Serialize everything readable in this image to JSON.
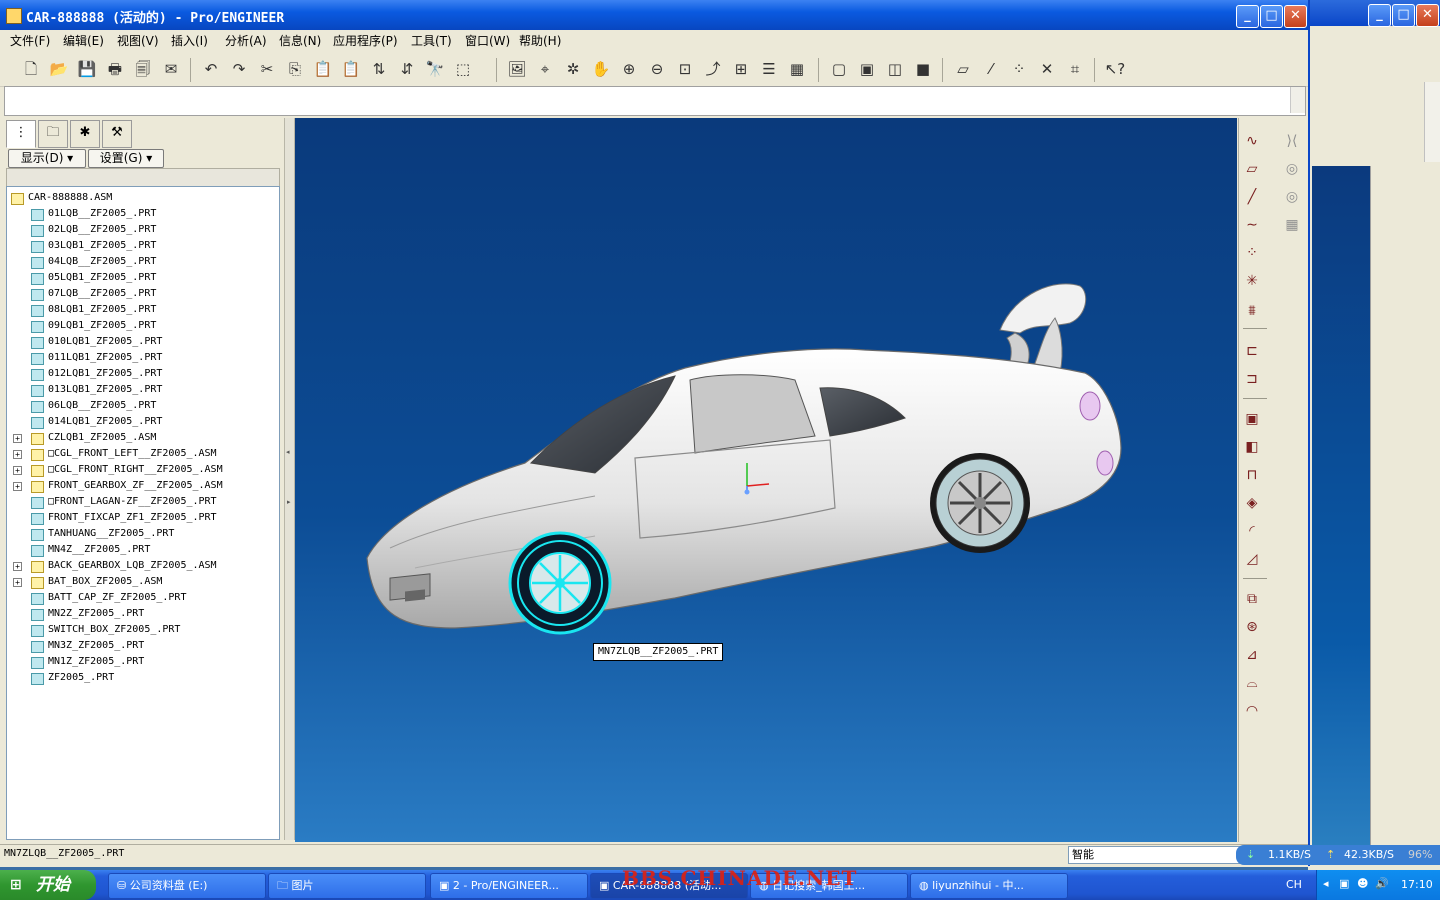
{
  "window": {
    "title": "CAR-888888 (活动的) - Pro/ENGINEER",
    "min": "_",
    "max": "□",
    "close": "✕"
  },
  "menu": [
    "文件(F)",
    "编辑(E)",
    "视图(V)",
    "插入(I)",
    "分析(A)",
    "信息(N)",
    "应用程序(P)",
    "工具(T)",
    "窗口(W)",
    "帮助(H)"
  ],
  "toolbar": {
    "icons": [
      {
        "name": "new-file-icon",
        "glyph": "🗋"
      },
      {
        "name": "open-folder-icon",
        "glyph": "📂"
      },
      {
        "name": "save-icon",
        "glyph": "💾"
      },
      {
        "name": "print-icon",
        "glyph": "🖶"
      },
      {
        "name": "print-preview-icon",
        "glyph": "🗐"
      },
      {
        "name": "send-mail-icon",
        "glyph": "✉"
      },
      {
        "name": "undo-icon",
        "glyph": "↶"
      },
      {
        "name": "redo-icon",
        "glyph": "↷"
      },
      {
        "name": "cut-icon",
        "glyph": "✂"
      },
      {
        "name": "copy-icon",
        "glyph": "⎘"
      },
      {
        "name": "paste-icon",
        "glyph": "📋"
      },
      {
        "name": "paste-special-icon",
        "glyph": "📋"
      },
      {
        "name": "regenerate-icon",
        "glyph": "⇅"
      },
      {
        "name": "regenerate-manager-icon",
        "glyph": "⇵"
      },
      {
        "name": "find-icon",
        "glyph": "🔭"
      },
      {
        "name": "select-box-icon",
        "glyph": "⬚"
      },
      {
        "name": "repaint-icon",
        "glyph": "🖼"
      },
      {
        "name": "spin-center-icon",
        "glyph": "⌖"
      },
      {
        "name": "orient-mode-icon",
        "glyph": "✲"
      },
      {
        "name": "pan-hand-icon",
        "glyph": "✋"
      },
      {
        "name": "zoom-in-icon",
        "glyph": "⊕"
      },
      {
        "name": "zoom-out-icon",
        "glyph": "⊖"
      },
      {
        "name": "refit-icon",
        "glyph": "⊡"
      },
      {
        "name": "reorient-icon",
        "glyph": "⤴"
      },
      {
        "name": "saved-views-icon",
        "glyph": "⊞"
      },
      {
        "name": "layers-icon",
        "glyph": "☰"
      },
      {
        "name": "view-manager-icon",
        "glyph": "▦"
      },
      {
        "name": "wireframe-icon",
        "glyph": "▢"
      },
      {
        "name": "hidden-line-icon",
        "glyph": "▣"
      },
      {
        "name": "no-hidden-icon",
        "glyph": "◫"
      },
      {
        "name": "shading-icon",
        "glyph": "■"
      },
      {
        "name": "datum-plane-display-icon",
        "glyph": "▱"
      },
      {
        "name": "datum-axis-display-icon",
        "glyph": "⁄"
      },
      {
        "name": "datum-point-display-icon",
        "glyph": "⁘"
      },
      {
        "name": "csys-display-icon",
        "glyph": "✕"
      },
      {
        "name": "annotation-display-icon",
        "glyph": "⌗"
      },
      {
        "name": "context-help-icon",
        "glyph": "↖?"
      }
    ]
  },
  "nav": {
    "tabs": [
      {
        "name": "model-tree-tab-icon",
        "glyph": "⋮"
      },
      {
        "name": "folder-browser-tab-icon",
        "glyph": "🗀"
      },
      {
        "name": "favorites-tab-icon",
        "glyph": "✱"
      },
      {
        "name": "connections-tab-icon",
        "glyph": "⚒"
      }
    ],
    "show_label": "显示(D) ▾",
    "settings_label": "设置(G) ▾"
  },
  "tree": [
    {
      "label": "CAR-888888.ASM",
      "type": "asm",
      "level": 0,
      "expander": ""
    },
    {
      "label": "01LQB__ZF2005_.PRT",
      "type": "prt",
      "level": 1,
      "expander": ""
    },
    {
      "label": "02LQB__ZF2005_.PRT",
      "type": "prt",
      "level": 1,
      "expander": ""
    },
    {
      "label": "03LQB1_ZF2005_.PRT",
      "type": "prt",
      "level": 1,
      "expander": ""
    },
    {
      "label": "04LQB__ZF2005_.PRT",
      "type": "prt",
      "level": 1,
      "expander": ""
    },
    {
      "label": "05LQB1_ZF2005_.PRT",
      "type": "prt",
      "level": 1,
      "expander": ""
    },
    {
      "label": "07LQB__ZF2005_.PRT",
      "type": "prt",
      "level": 1,
      "expander": ""
    },
    {
      "label": "08LQB1_ZF2005_.PRT",
      "type": "prt",
      "level": 1,
      "expander": ""
    },
    {
      "label": "09LQB1_ZF2005_.PRT",
      "type": "prt",
      "level": 1,
      "expander": ""
    },
    {
      "label": "010LQB1_ZF2005_.PRT",
      "type": "prt",
      "level": 1,
      "expander": ""
    },
    {
      "label": "011LQB1_ZF2005_.PRT",
      "type": "prt",
      "level": 1,
      "expander": ""
    },
    {
      "label": "012LQB1_ZF2005_.PRT",
      "type": "prt",
      "level": 1,
      "expander": ""
    },
    {
      "label": "013LQB1_ZF2005_.PRT",
      "type": "prt",
      "level": 1,
      "expander": ""
    },
    {
      "label": "06LQB__ZF2005_.PRT",
      "type": "prt",
      "level": 1,
      "expander": ""
    },
    {
      "label": "014LQB1_ZF2005_.PRT",
      "type": "prt",
      "level": 1,
      "expander": ""
    },
    {
      "label": "CZLQB1_ZF2005_.ASM",
      "type": "asm",
      "level": 1,
      "expander": "+"
    },
    {
      "label": "□CGL_FRONT_LEFT__ZF2005_.ASM",
      "type": "asm",
      "level": 1,
      "expander": "+"
    },
    {
      "label": "□CGL_FRONT_RIGHT__ZF2005_.ASM",
      "type": "asm",
      "level": 1,
      "expander": "+"
    },
    {
      "label": "FRONT_GEARBOX_ZF__ZF2005_.ASM",
      "type": "asm",
      "level": 1,
      "expander": "+"
    },
    {
      "label": "□FRONT_LAGAN-ZF__ZF2005_.PRT",
      "type": "prt",
      "level": 1,
      "expander": ""
    },
    {
      "label": "FRONT_FIXCAP_ZF1_ZF2005_.PRT",
      "type": "prt",
      "level": 1,
      "expander": ""
    },
    {
      "label": "TANHUANG__ZF2005_.PRT",
      "type": "prt",
      "level": 1,
      "expander": ""
    },
    {
      "label": "MN4Z__ZF2005_.PRT",
      "type": "prt",
      "level": 1,
      "expander": ""
    },
    {
      "label": "BACK_GEARBOX_LQB_ZF2005_.ASM",
      "type": "asm",
      "level": 1,
      "expander": "+"
    },
    {
      "label": "BAT_BOX_ZF2005_.ASM",
      "type": "asm",
      "level": 1,
      "expander": "+"
    },
    {
      "label": "BATT_CAP_ZF_ZF2005_.PRT",
      "type": "prt",
      "level": 1,
      "expander": ""
    },
    {
      "label": "MN2Z_ZF2005_.PRT",
      "type": "prt",
      "level": 1,
      "expander": ""
    },
    {
      "label": "SWITCH_BOX_ZF2005_.PRT",
      "type": "prt",
      "level": 1,
      "expander": ""
    },
    {
      "label": "MN3Z_ZF2005_.PRT",
      "type": "prt",
      "level": 1,
      "expander": ""
    },
    {
      "label": "MN1Z_ZF2005_.PRT",
      "type": "prt",
      "level": 1,
      "expander": ""
    },
    {
      "label": "ZF2005_.PRT",
      "type": "prt",
      "level": 1,
      "expander": ""
    }
  ],
  "viewport": {
    "tooltip": "MN7ZLQB__ZF2005_.PRT",
    "highlight_color": "#19e6f0",
    "model_color": "#e8e8e8"
  },
  "right_toolbar": [
    {
      "name": "sketch-tool-icon",
      "glyph": "∿"
    },
    {
      "name": "datum-plane-tool-icon",
      "glyph": "▱"
    },
    {
      "name": "datum-axis-tool-icon",
      "glyph": "╱"
    },
    {
      "name": "datum-curve-tool-icon",
      "glyph": "∼"
    },
    {
      "name": "datum-point-tool-icon",
      "glyph": "⁘"
    },
    {
      "name": "datum-csys-tool-icon",
      "glyph": "✳"
    },
    {
      "name": "analysis-tool-icon",
      "glyph": "⩩"
    },
    {
      "name": "assemble-component-icon",
      "glyph": "⊏"
    },
    {
      "name": "create-component-icon",
      "glyph": "⊐"
    },
    {
      "name": "pattern-icon",
      "glyph": "▣"
    },
    {
      "name": "merge-icon",
      "glyph": "◧"
    },
    {
      "name": "cut-out-icon",
      "glyph": "⊓"
    },
    {
      "name": "hole-icon",
      "glyph": "◈"
    },
    {
      "name": "round-icon",
      "glyph": "◜"
    },
    {
      "name": "chamfer-icon",
      "glyph": "◿"
    },
    {
      "name": "offset-icon",
      "glyph": "⧉"
    },
    {
      "name": "axis-pattern-icon",
      "glyph": "⊛"
    },
    {
      "name": "draft-icon",
      "glyph": "⊿"
    },
    {
      "name": "surface-icon",
      "glyph": "⌓"
    },
    {
      "name": "boundary-blend-icon",
      "glyph": "◠"
    }
  ],
  "status": {
    "text": "MN7ZLQB__ZF2005_.PRT",
    "filter": "智能",
    "down_speed": "1.1KB/S",
    "up_speed": "42.3KB/S",
    "percent": "96%"
  },
  "taskbar": {
    "start": "开始",
    "tasks": [
      "公司资料盘 (E:)",
      "图片",
      "2 - Pro/ENGINEER...",
      "CAR-888888 (活动...",
      "日记搜索_韩国工...",
      "liyunzhihui - 中..."
    ],
    "lang": "CH",
    "clock": "17:10",
    "watermark": "BBS.CHINADE.NET"
  }
}
